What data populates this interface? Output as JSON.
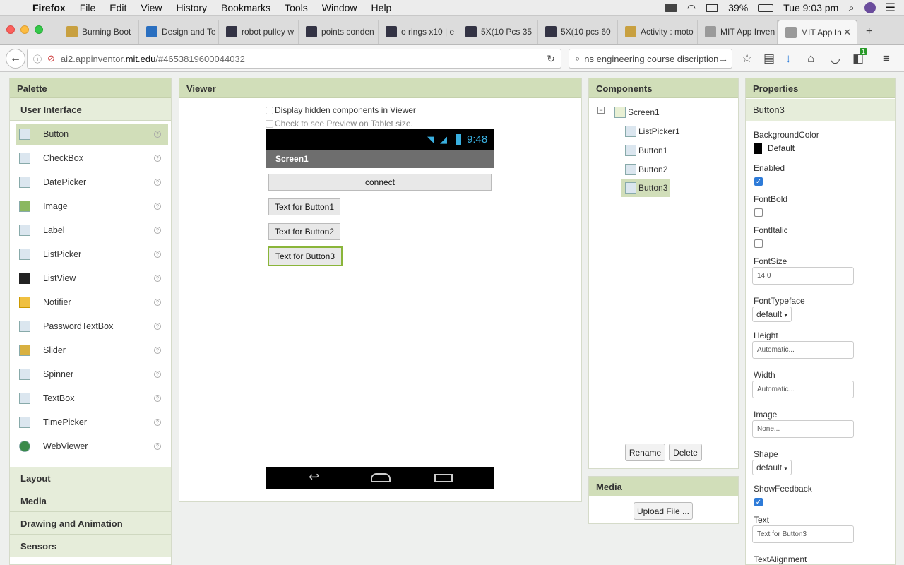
{
  "menubar": {
    "app": "Firefox",
    "items": [
      "File",
      "Edit",
      "View",
      "History",
      "Bookmarks",
      "Tools",
      "Window",
      "Help"
    ],
    "battery": "39%",
    "clock": "Tue 9:03 pm"
  },
  "tabs": [
    {
      "label": "Burning Boot",
      "color": "#c8a040"
    },
    {
      "label": "Design and Te",
      "color": "#2a6fc0"
    },
    {
      "label": "robot pulley w",
      "color": "#334"
    },
    {
      "label": "points conden",
      "color": "#334"
    },
    {
      "label": "o rings x10 | e",
      "color": "#334"
    },
    {
      "label": "5X(10 Pcs 35",
      "color": "#334"
    },
    {
      "label": "5X(10 pcs 60",
      "color": "#334"
    },
    {
      "label": "Activity : moto",
      "color": "#c8a040"
    },
    {
      "label": "MIT App Inven",
      "color": "#9a9a9a"
    },
    {
      "label": "MIT App In",
      "color": "#9a9a9a"
    }
  ],
  "nav": {
    "url_prefix": "ai2.appinventor.",
    "url_host": "mit.edu",
    "url_rest": "/#4653819600044032",
    "search": "ns engineering course discription",
    "badge": "1"
  },
  "palette": {
    "title": "Palette",
    "section": "User Interface",
    "items": [
      {
        "label": "Button",
        "icon": "button-icon"
      },
      {
        "label": "CheckBox",
        "icon": "checkbox-icon"
      },
      {
        "label": "DatePicker",
        "icon": "datepicker-icon"
      },
      {
        "label": "Image",
        "icon": "image-icon"
      },
      {
        "label": "Label",
        "icon": "label-icon"
      },
      {
        "label": "ListPicker",
        "icon": "listpicker-icon"
      },
      {
        "label": "ListView",
        "icon": "listview-icon"
      },
      {
        "label": "Notifier",
        "icon": "notifier-icon"
      },
      {
        "label": "PasswordTextBox",
        "icon": "password-icon"
      },
      {
        "label": "Slider",
        "icon": "slider-icon"
      },
      {
        "label": "Spinner",
        "icon": "spinner-icon"
      },
      {
        "label": "TextBox",
        "icon": "textbox-icon"
      },
      {
        "label": "TimePicker",
        "icon": "timepicker-icon"
      },
      {
        "label": "WebViewer",
        "icon": "webviewer-icon"
      }
    ],
    "sections": [
      "Layout",
      "Media",
      "Drawing and Animation",
      "Sensors"
    ]
  },
  "viewer": {
    "title": "Viewer",
    "hidden_label": "Display hidden components in Viewer",
    "tablet_label": "Check to see Preview on Tablet size.",
    "phone_time": "9:48",
    "screen_title": "Screen1",
    "connect": "connect",
    "button1": "Text for Button1",
    "button2": "Text for Button2",
    "button3": "Text for Button3"
  },
  "components": {
    "title": "Components",
    "screen": "Screen1",
    "items": [
      "ListPicker1",
      "Button1",
      "Button2",
      "Button3"
    ],
    "rename": "Rename",
    "delete": "Delete"
  },
  "media": {
    "title": "Media",
    "upload": "Upload File ..."
  },
  "properties": {
    "title": "Properties",
    "component": "Button3",
    "bg_label": "BackgroundColor",
    "bg_value": "Default",
    "enabled": "Enabled",
    "fontbold": "FontBold",
    "fontitalic": "FontItalic",
    "fontsize": "FontSize",
    "fontsize_value": "14.0",
    "typeface": "FontTypeface",
    "typeface_value": "default",
    "height": "Height",
    "height_value": "Automatic...",
    "width": "Width",
    "width_value": "Automatic...",
    "image": "Image",
    "image_value": "None...",
    "shape": "Shape",
    "shape_value": "default",
    "feedback": "ShowFeedback",
    "text": "Text",
    "text_value": "Text for Button3",
    "align": "TextAlignment"
  }
}
